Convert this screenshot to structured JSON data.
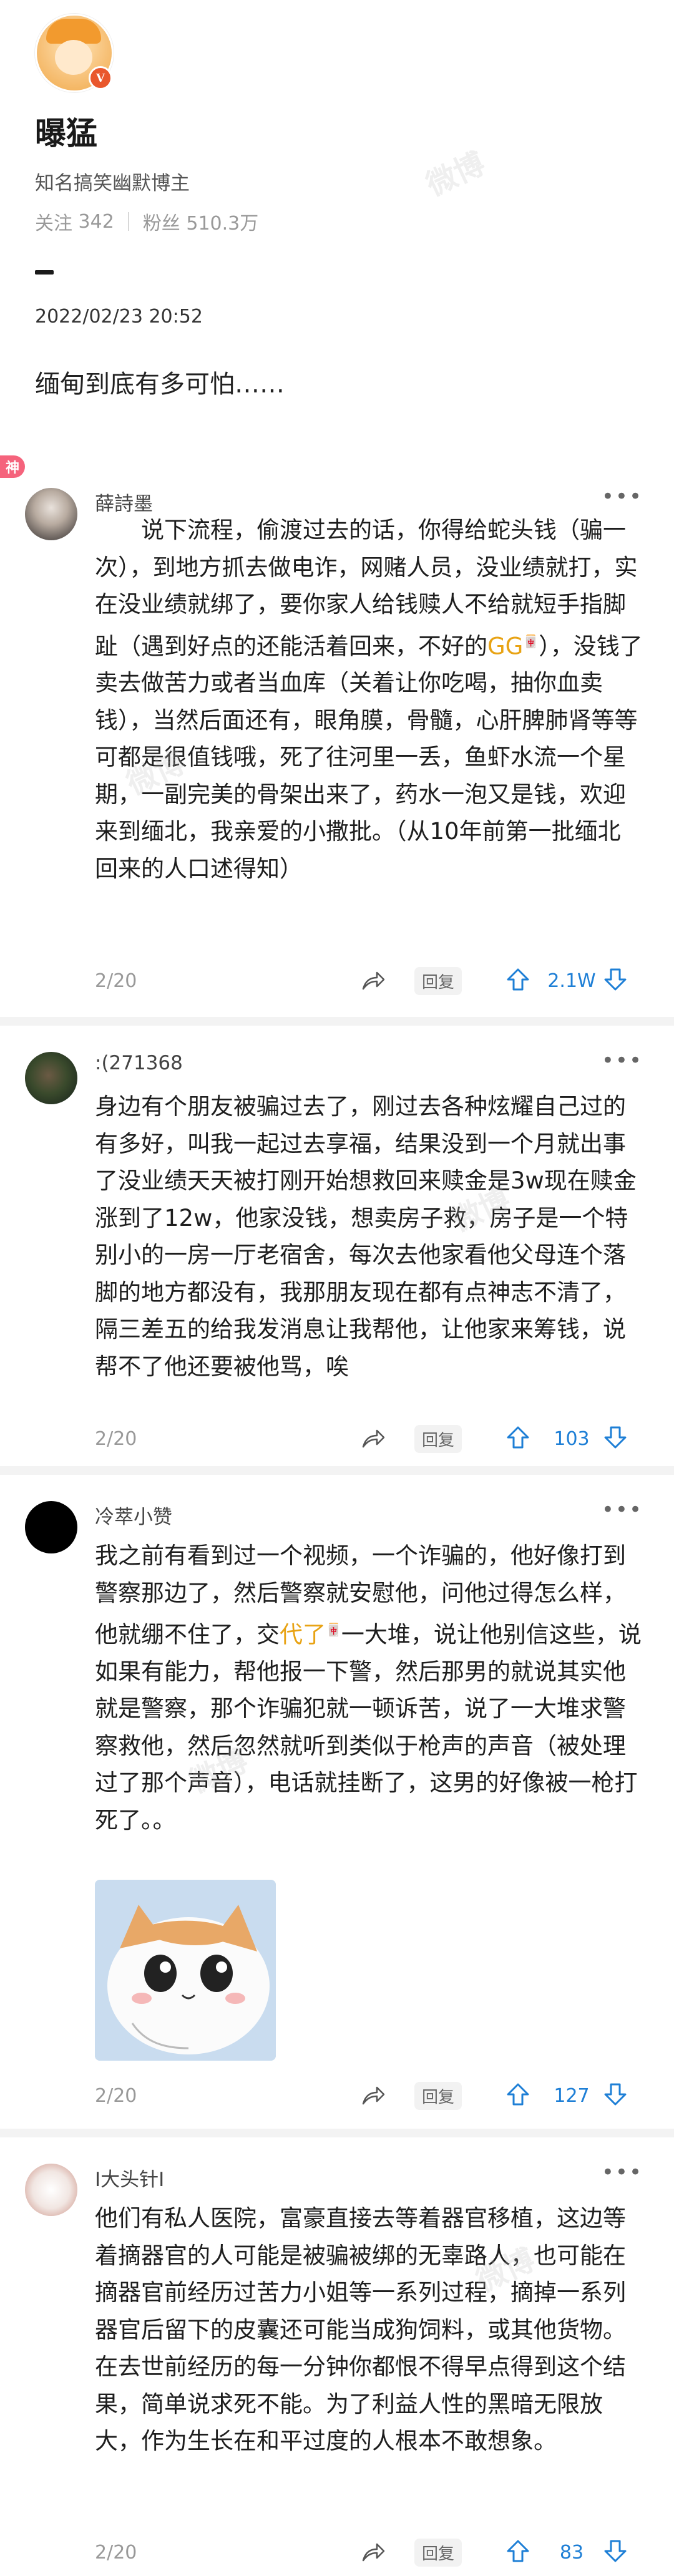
{
  "profile": {
    "name": "曝猛",
    "verified_mark": "V",
    "description": "知名搞笑幽默博主",
    "follow_label": "关注",
    "follow_count": "342",
    "fans_label": "粉丝",
    "fans_count": "510.3万"
  },
  "post": {
    "date": "2022/02/23 20:52",
    "text": "缅甸到底有多可怕……"
  },
  "badge_label": "神",
  "comments": [
    {
      "user": "薛詩墨",
      "more": "•••",
      "text_pre": "　　说下流程，偷渡过去的话，你得给蛇头钱（骗一次），到地方抓去做电诈，网赌人员，没业绩就打，实在没业绩就绑了，要你家人给钱赎人不给就短手指脚趾（遇到好点的还能活着回来，不好的",
      "text_link": "GG",
      "text_sup": "🀄",
      "text_post": "），没钱了卖去做苦力或者当血库（关着让你吃喝，抽你血卖钱），当然后面还有，眼角膜，骨髓，心肝脾肺肾等等可都是很值钱哦，死了往河里一丢，鱼虾水流一个星期，一副完美的骨架出来了，药水一泡又是钱，欢迎来到缅北，我亲爱的小撒批。（从10年前第一批缅北回来的人口述得知）",
      "date": "2/20",
      "reply": "回复",
      "likes": "2.1W"
    },
    {
      "user": ":(271368",
      "more": "•••",
      "text": "身边有个朋友被骗过去了，刚过去各种炫耀自己过的有多好，叫我一起过去享福，结果没到一个月就出事了没业绩天天被打刚开始想救回来赎金是3w现在赎金涨到了12w，他家没钱，想卖房子救，房子是一个特别小的一房一厅老宿舍，每次去他家看他父母连个落脚的地方都没有，我那朋友现在都有点神志不清了，隔三差五的给我发消息让我帮他，让他家来筹钱，说帮不了他还要被他骂，唉",
      "date": "2/20",
      "reply": "回复",
      "likes": "103"
    },
    {
      "user": "冷萃小赞",
      "more": "•••",
      "text_pre": "我之前有看到过一个视频，一个诈骗的，他好像打到警察那边了，然后警察就安慰他，问他过得怎么样，他就绷不住了，交",
      "text_link": "代了",
      "text_sup": "🀄",
      "text_post": "一大堆，说让他别信这些，说如果有能力，帮他报一下警，然后那男的就说其实他就是警察，那个诈骗犯就一顿诉苦，说了一大堆求警察救他，然后忽然就听到类似于枪声的声音（被处理过了那个声音），电话就挂断了，这男的好像被一枪打死了。。",
      "date": "2/20",
      "reply": "回复",
      "likes": "127"
    },
    {
      "user": "I大头针I",
      "more": "•••",
      "text": "他们有私人医院，富豪直接去等着器官移植，这边等着摘器官的人可能是被骗被绑的无辜路人，也可能在摘器官前经历过苦力小姐等一系列过程，摘掉一系列器官后留下的皮囊还可能当成狗饲料，或其他货物。在去世前经历的每一分钟你都恨不得早点得到这个结果，简单说求死不能。为了利益人性的黑暗无限放大，作为生长在和平过度的人根本不敢想象。",
      "date": "2/20",
      "reply": "回复",
      "likes": "83"
    }
  ],
  "watermark": "微博"
}
